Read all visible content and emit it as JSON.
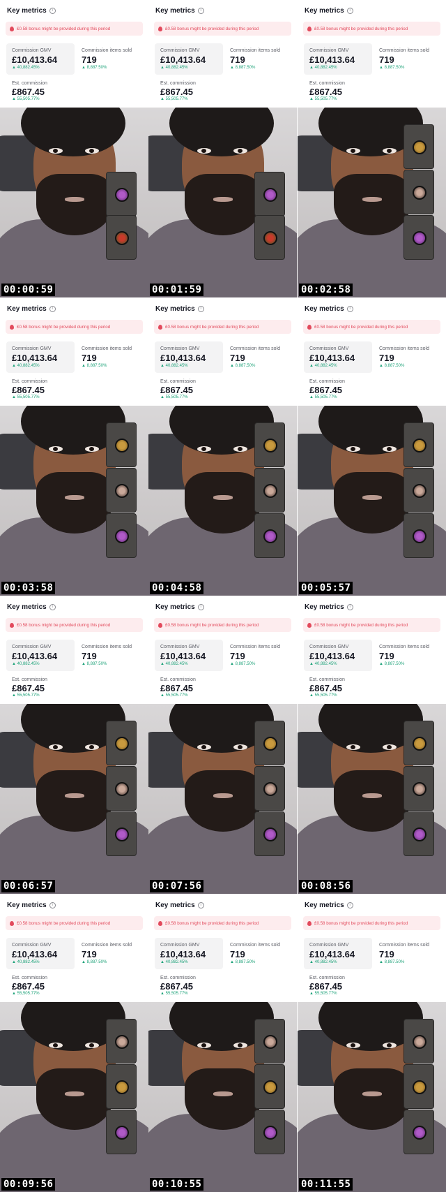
{
  "metrics": {
    "key_metrics_label": "Key metrics",
    "info_icon_glyph": "i",
    "bonus_text": "£0.58 bonus might be provided during this period",
    "gmv_label": "Commission GMV",
    "gmv_value": "£10,413.64",
    "gmv_change": "▲ 40,882.45%",
    "items_label": "Commission items sold",
    "items_value": "719",
    "items_change": "▲ 8,887.50%",
    "commission_label": "Est. commission",
    "commission_value": "£867.45",
    "commission_change": "▲ 55,505.77%"
  },
  "icons": {
    "info": "info-icon",
    "bonus": "flame-icon",
    "avatar_styles": [
      "avatar-gold",
      "avatar-purple",
      "avatar-woman",
      "avatar-red"
    ]
  },
  "colors": {
    "bonus_bg": "#fdecee",
    "bonus_text": "#e24a5c",
    "positive_change": "#1fa37a"
  },
  "frames": [
    {
      "timestamp": "00:00:59",
      "pips": [
        "avatar-purple",
        "avatar-red"
      ]
    },
    {
      "timestamp": "00:01:59",
      "pips": [
        "avatar-purple",
        "avatar-red"
      ]
    },
    {
      "timestamp": "00:02:58",
      "pips": [
        "avatar-gold",
        "avatar-woman",
        "avatar-purple"
      ]
    },
    {
      "timestamp": "00:03:58",
      "pips": [
        "avatar-gold",
        "avatar-woman",
        "avatar-purple"
      ]
    },
    {
      "timestamp": "00:04:58",
      "pips": [
        "avatar-gold",
        "avatar-woman",
        "avatar-purple"
      ]
    },
    {
      "timestamp": "00:05:57",
      "pips": [
        "avatar-gold",
        "avatar-woman",
        "avatar-purple"
      ]
    },
    {
      "timestamp": "00:06:57",
      "pips": [
        "avatar-gold",
        "avatar-woman",
        "avatar-purple"
      ]
    },
    {
      "timestamp": "00:07:56",
      "pips": [
        "avatar-gold",
        "avatar-woman",
        "avatar-purple"
      ]
    },
    {
      "timestamp": "00:08:56",
      "pips": [
        "avatar-gold",
        "avatar-woman",
        "avatar-purple"
      ]
    },
    {
      "timestamp": "00:09:56",
      "pips": [
        "avatar-woman",
        "avatar-gold",
        "avatar-purple"
      ]
    },
    {
      "timestamp": "00:10:55",
      "pips": [
        "avatar-woman",
        "avatar-gold",
        "avatar-purple"
      ]
    },
    {
      "timestamp": "00:11:55",
      "pips": [
        "avatar-woman",
        "avatar-gold",
        "avatar-purple"
      ]
    }
  ]
}
